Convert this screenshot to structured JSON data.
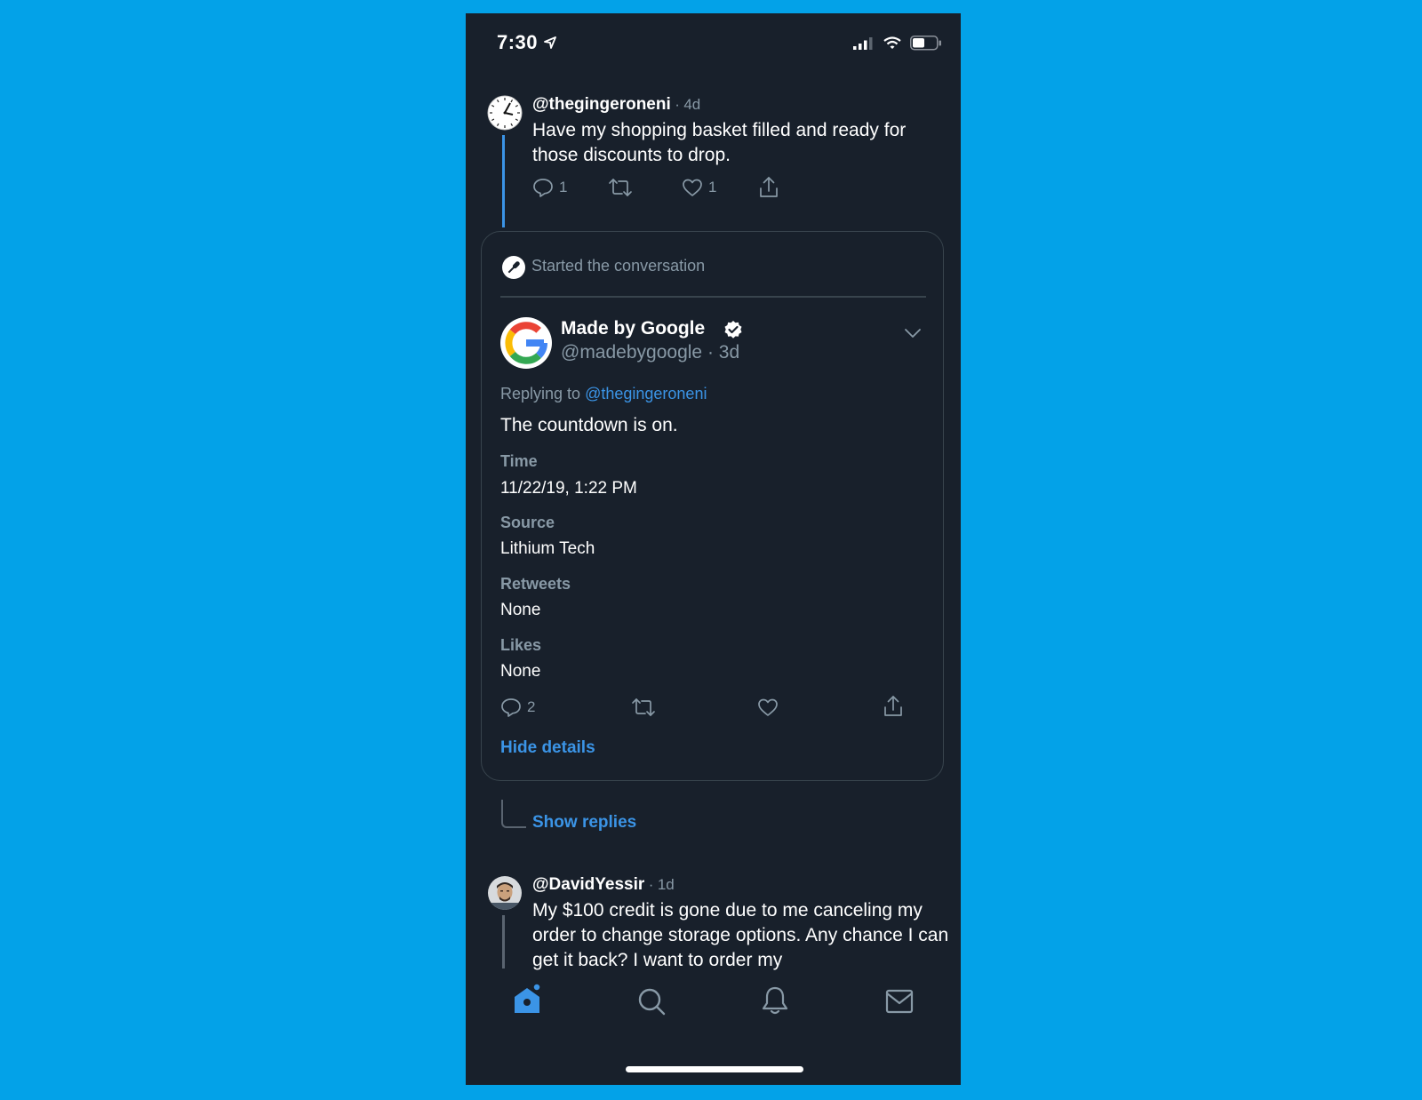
{
  "status_bar": {
    "time": "7:30"
  },
  "tweet1": {
    "handle": "@thegingeroneni",
    "time": "4d",
    "text": "Have my shopping basket filled and ready for those discounts to drop.",
    "reply_count": "1",
    "like_count": "1"
  },
  "card": {
    "header": "Started the conversation",
    "author_name": "Made by Google",
    "author_handle": "@madebygoogle",
    "time": "3d",
    "replying_prefix": "Replying to",
    "replying_handle": "@thegingeroneni",
    "text": "The countdown is on.",
    "details": [
      {
        "label": "Time",
        "value": "11/22/19, 1:22 PM"
      },
      {
        "label": "Source",
        "value": "Lithium Tech"
      },
      {
        "label": "Retweets",
        "value": "None"
      },
      {
        "label": "Likes",
        "value": "None"
      }
    ],
    "reply_count": "2",
    "hide_details": "Hide details"
  },
  "show_replies": "Show replies",
  "tweet2": {
    "handle": "@DavidYessir",
    "time": "1d",
    "text": "My $100 credit is gone due to me canceling my order to change storage options. Any chance I can get it back? I want to order my"
  },
  "colors": {
    "background": "#03a2e8",
    "screen": "#18202b",
    "accent": "#3b94e6",
    "muted": "#8899a6"
  },
  "icons": [
    "location-arrow-icon",
    "signal-icon",
    "wifi-icon",
    "battery-icon",
    "reply-icon",
    "retweet-icon",
    "like-icon",
    "share-icon",
    "microphone-icon",
    "verified-icon",
    "chevron-down-icon",
    "home-icon",
    "search-icon",
    "bell-icon",
    "mail-icon"
  ]
}
